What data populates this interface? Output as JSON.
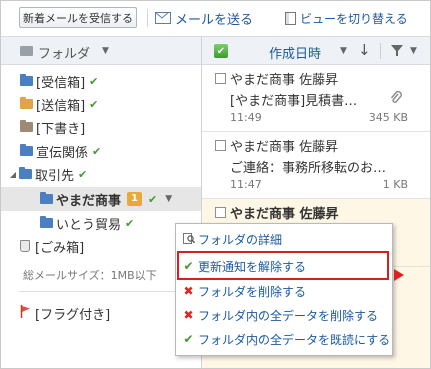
{
  "toolbar": {
    "receive_label": "新着メールを受信する",
    "compose_label": "メールを送る",
    "view_label": "ビューを切り替える"
  },
  "left_header": {
    "label": "フォルダ"
  },
  "right_header": {
    "sort_label": "作成日時"
  },
  "folders": [
    {
      "label": "[受信箱]"
    },
    {
      "label": "[送信箱]"
    },
    {
      "label": "[下書き]"
    },
    {
      "label": "宣伝関係"
    },
    {
      "label": "取引先"
    },
    {
      "label": "やまだ商事",
      "badge": "1"
    },
    {
      "label": "いとう貿易"
    },
    {
      "label": "[ごみ箱]"
    }
  ],
  "total_size": "総メールサイズ：1MB以下",
  "flag_folder": "[フラグ付き]",
  "mails": [
    {
      "from": "やまだ商事 佐藤昇",
      "subject": "[やまだ商事]見積書…",
      "time": "11:49",
      "size": "345 KB"
    },
    {
      "from": "やまだ商事 佐藤昇",
      "subject": "ご連絡：事務所移転のお…",
      "time": "11:47",
      "size": "1 KB"
    },
    {
      "from": "やまだ商事 佐藤昇",
      "subject": "",
      "time": "",
      "size": ""
    }
  ],
  "context_menu": {
    "items": [
      {
        "label": "フォルダの詳細"
      },
      {
        "label": "更新通知を解除する"
      },
      {
        "label": "フォルダを削除する"
      },
      {
        "label": "フォルダ内の全データを削除する"
      },
      {
        "label": "フォルダ内の全データを既読にする"
      }
    ]
  },
  "colors": {
    "accent": "#1a5aa0",
    "highlight_border": "#d32020",
    "check_green": "#3e9b2f"
  }
}
